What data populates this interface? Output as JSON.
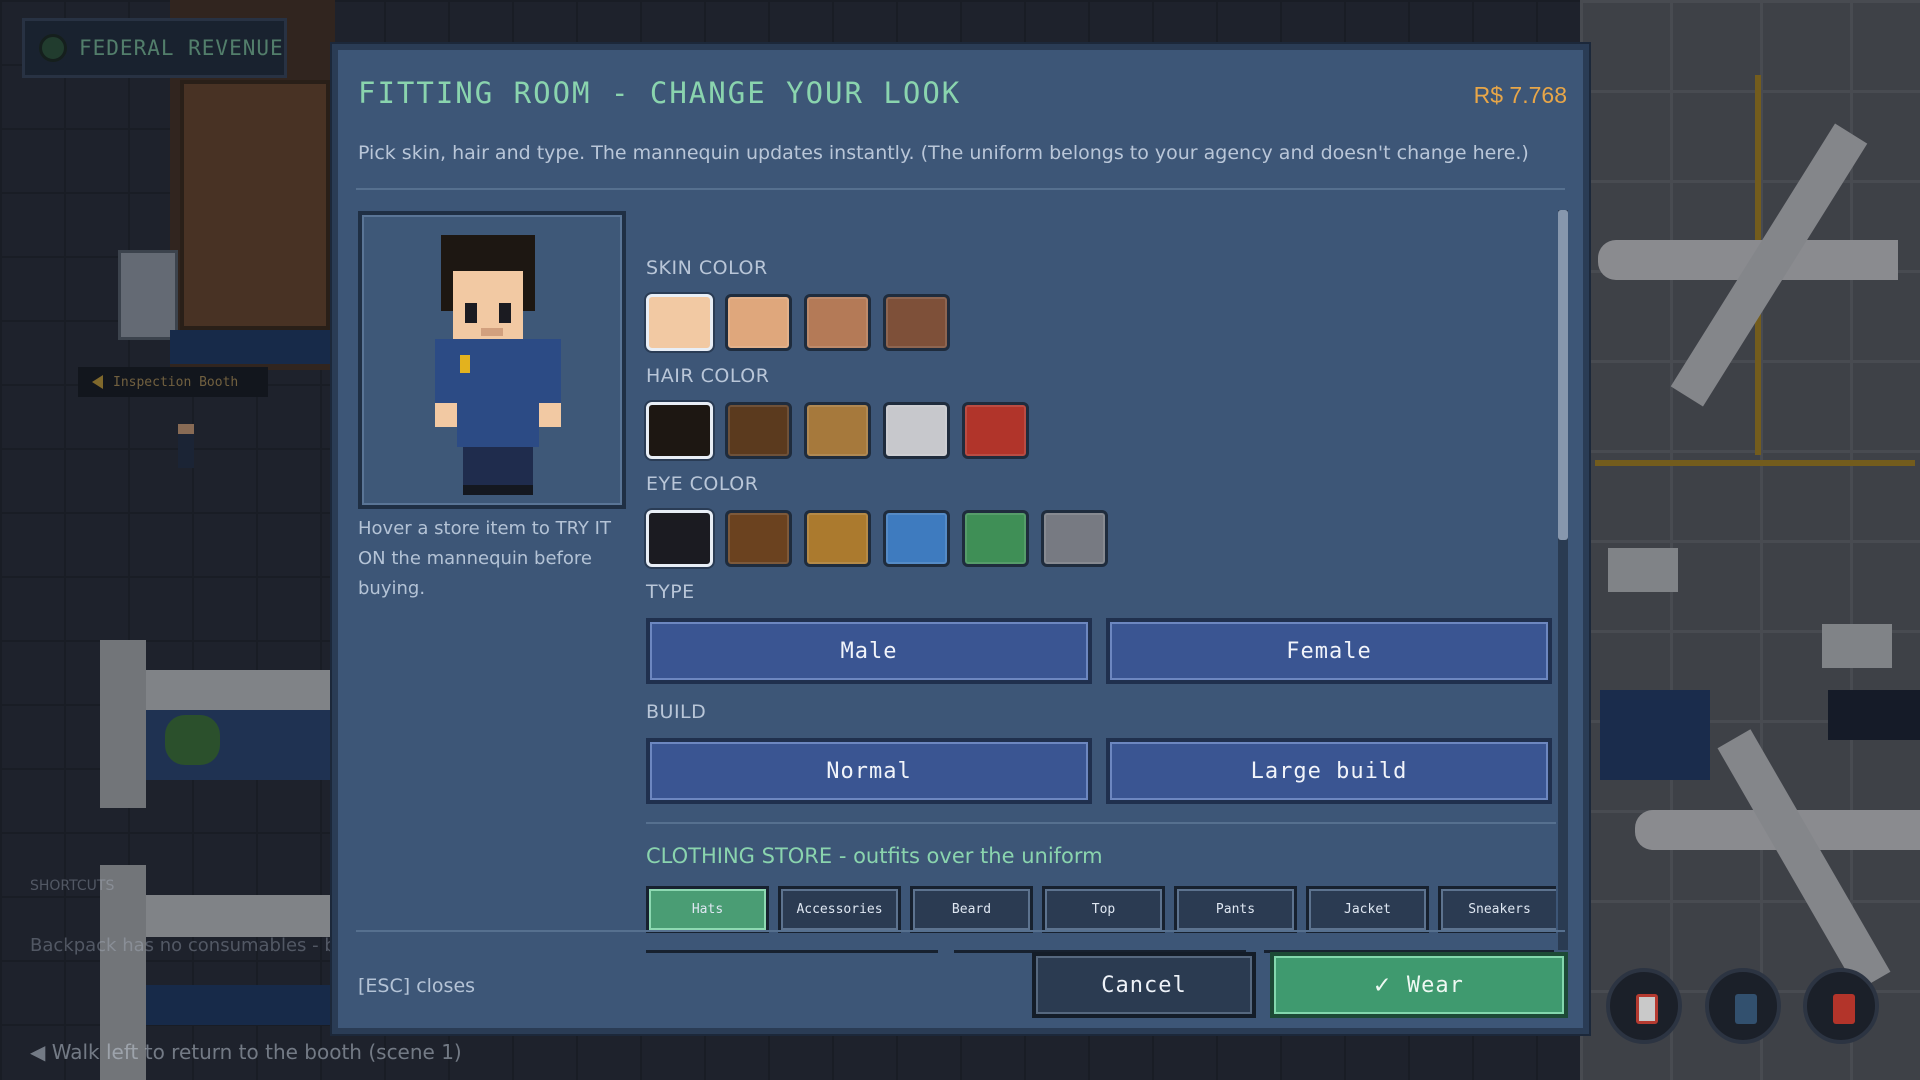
{
  "background": {
    "agency_badge": "FEDERAL REVENUE",
    "booth_sign": "Inspection Booth",
    "shortcuts_heading": "SHORTCUTS",
    "shortcuts_text": "Backpack has no consumables - bu",
    "walk_hint": "◀ Walk left to return to the booth (scene 1)"
  },
  "modal": {
    "title": "FITTING ROOM - CHANGE YOUR LOOK",
    "money": "R$ 7.768",
    "subtitle": "Pick skin, hair and type. The mannequin updates instantly. (The uniform belongs to your agency and doesn't change here.)",
    "hint": "Hover a store item to TRY IT ON the mannequin before buying.",
    "skin": {
      "label": "SKIN COLOR",
      "selected_index": 0,
      "swatches": [
        "#f2c9a3",
        "#dfa77c",
        "#b47a57",
        "#7e5039"
      ]
    },
    "hair": {
      "label": "HAIR COLOR",
      "selected_index": 0,
      "swatches": [
        "#1d1712",
        "#5b3a1e",
        "#a6793c",
        "#c7c8cc",
        "#b1342a"
      ]
    },
    "eyes": {
      "label": "EYE COLOR",
      "selected_index": 0,
      "swatches": [
        "#1b1b21",
        "#6b421f",
        "#ab7a2e",
        "#3e7bbf",
        "#3f8f56",
        "#777a82"
      ]
    },
    "type": {
      "label": "TYPE",
      "options": [
        "Male",
        "Female"
      ]
    },
    "build": {
      "label": "BUILD",
      "options": [
        "Normal",
        "Large build"
      ]
    },
    "store": {
      "title": "CLOTHING STORE - outfits over the uniform",
      "tabs": [
        "Hats",
        "Accessories",
        "Beard",
        "Top",
        "Pants",
        "Jacket",
        "Sneakers"
      ],
      "selected_tab": "Hats"
    },
    "esc_hint": "[ESC] closes",
    "cancel_label": "Cancel",
    "wear_label": "Wear",
    "wear_icon": "✓"
  },
  "colors": {
    "accent_green": "#8ad4ae",
    "money_orange": "#e8a648",
    "panel_bg": "#3d5677"
  }
}
